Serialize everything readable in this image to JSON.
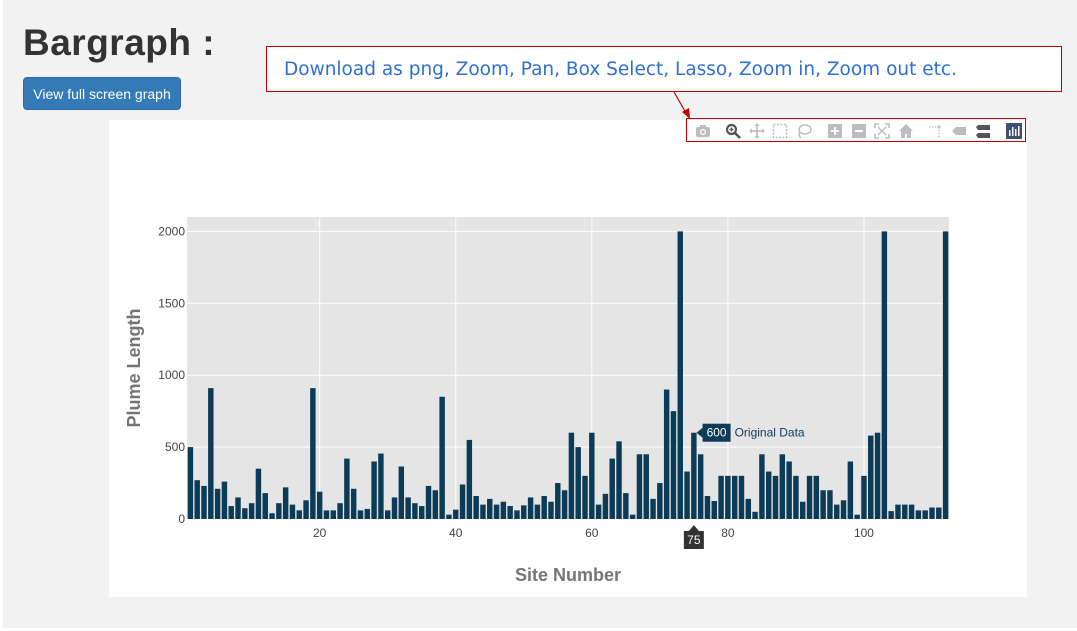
{
  "page": {
    "title": "Bargraph :",
    "fullscreen_button": "View full screen graph"
  },
  "callout": {
    "text": "Download as png, Zoom, Pan, Box Select, Lasso, Zoom in, Zoom out etc."
  },
  "modebar": {
    "icons": [
      "camera-icon",
      "zoom-icon",
      "pan-icon",
      "box-select-icon",
      "lasso-icon",
      "zoom-in-icon",
      "zoom-out-icon",
      "autoscale-icon",
      "reset-axes-icon",
      "spike-lines-icon",
      "hover-closest-icon",
      "hover-compare-icon",
      "plotly-logo-icon"
    ]
  },
  "colors": {
    "bar": "#0c3b57",
    "plot_bg": "#e5e5e5",
    "accent": "#337ab7",
    "callout_border": "#c00000",
    "callout_text": "#2f6fd1"
  },
  "chart_data": {
    "type": "bar",
    "xlabel": "Site Number",
    "ylabel": "Plume Length",
    "x_ticks": [
      20,
      40,
      60,
      80,
      100
    ],
    "y_ticks": [
      0,
      500,
      1000,
      1500,
      2000
    ],
    "xlim": [
      0.5,
      112.5
    ],
    "ylim": [
      0,
      2100
    ],
    "grid": true,
    "x": [
      1,
      2,
      3,
      4,
      5,
      6,
      7,
      8,
      9,
      10,
      11,
      12,
      13,
      14,
      15,
      16,
      17,
      18,
      19,
      20,
      21,
      22,
      23,
      24,
      25,
      26,
      27,
      28,
      29,
      30,
      31,
      32,
      33,
      34,
      35,
      36,
      37,
      38,
      39,
      40,
      41,
      42,
      43,
      44,
      45,
      46,
      47,
      48,
      49,
      50,
      51,
      52,
      53,
      54,
      55,
      56,
      57,
      58,
      59,
      60,
      61,
      62,
      63,
      64,
      65,
      66,
      67,
      68,
      69,
      70,
      71,
      72,
      73,
      74,
      75,
      76,
      77,
      78,
      79,
      80,
      81,
      82,
      83,
      84,
      85,
      86,
      87,
      88,
      89,
      90,
      91,
      92,
      93,
      94,
      95,
      96,
      97,
      98,
      99,
      100,
      101,
      102,
      103,
      104,
      105,
      106,
      107,
      108,
      109,
      110,
      111,
      112
    ],
    "values": [
      500,
      270,
      230,
      910,
      210,
      260,
      90,
      150,
      75,
      110,
      350,
      180,
      40,
      110,
      220,
      100,
      60,
      130,
      910,
      190,
      60,
      60,
      110,
      420,
      210,
      60,
      70,
      400,
      455,
      60,
      150,
      365,
      150,
      110,
      90,
      230,
      200,
      850,
      30,
      65,
      240,
      550,
      160,
      100,
      140,
      100,
      120,
      90,
      60,
      95,
      150,
      100,
      160,
      120,
      250,
      200,
      600,
      500,
      300,
      600,
      100,
      175,
      420,
      540,
      180,
      30,
      450,
      450,
      140,
      250,
      900,
      750,
      2000,
      330,
      600,
      450,
      160,
      125,
      300,
      300,
      300,
      300,
      140,
      50,
      450,
      330,
      300,
      450,
      400,
      300,
      120,
      300,
      300,
      200,
      200,
      100,
      130,
      400,
      30,
      300,
      580,
      600,
      2000,
      55,
      100,
      100,
      100,
      60,
      60,
      80,
      80,
      2000
    ],
    "hover": {
      "x": 75,
      "value_label": "600",
      "series_label": "Original Data",
      "x_label": "75"
    }
  }
}
